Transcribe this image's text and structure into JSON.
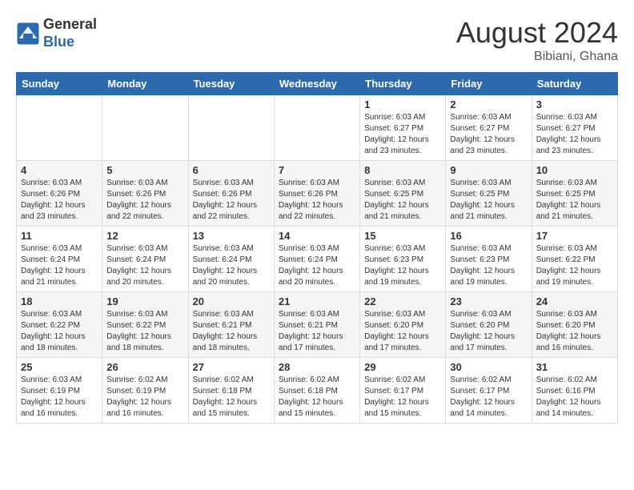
{
  "header": {
    "logo_line1": "General",
    "logo_line2": "Blue",
    "month_year": "August 2024",
    "location": "Bibiani, Ghana"
  },
  "weekdays": [
    "Sunday",
    "Monday",
    "Tuesday",
    "Wednesday",
    "Thursday",
    "Friday",
    "Saturday"
  ],
  "weeks": [
    [
      {
        "day": "",
        "sunrise": "",
        "sunset": "",
        "daylight": ""
      },
      {
        "day": "",
        "sunrise": "",
        "sunset": "",
        "daylight": ""
      },
      {
        "day": "",
        "sunrise": "",
        "sunset": "",
        "daylight": ""
      },
      {
        "day": "",
        "sunrise": "",
        "sunset": "",
        "daylight": ""
      },
      {
        "day": "1",
        "sunrise": "Sunrise: 6:03 AM",
        "sunset": "Sunset: 6:27 PM",
        "daylight": "Daylight: 12 hours and 23 minutes."
      },
      {
        "day": "2",
        "sunrise": "Sunrise: 6:03 AM",
        "sunset": "Sunset: 6:27 PM",
        "daylight": "Daylight: 12 hours and 23 minutes."
      },
      {
        "day": "3",
        "sunrise": "Sunrise: 6:03 AM",
        "sunset": "Sunset: 6:27 PM",
        "daylight": "Daylight: 12 hours and 23 minutes."
      }
    ],
    [
      {
        "day": "4",
        "sunrise": "Sunrise: 6:03 AM",
        "sunset": "Sunset: 6:26 PM",
        "daylight": "Daylight: 12 hours and 23 minutes."
      },
      {
        "day": "5",
        "sunrise": "Sunrise: 6:03 AM",
        "sunset": "Sunset: 6:26 PM",
        "daylight": "Daylight: 12 hours and 22 minutes."
      },
      {
        "day": "6",
        "sunrise": "Sunrise: 6:03 AM",
        "sunset": "Sunset: 6:26 PM",
        "daylight": "Daylight: 12 hours and 22 minutes."
      },
      {
        "day": "7",
        "sunrise": "Sunrise: 6:03 AM",
        "sunset": "Sunset: 6:26 PM",
        "daylight": "Daylight: 12 hours and 22 minutes."
      },
      {
        "day": "8",
        "sunrise": "Sunrise: 6:03 AM",
        "sunset": "Sunset: 6:25 PM",
        "daylight": "Daylight: 12 hours and 21 minutes."
      },
      {
        "day": "9",
        "sunrise": "Sunrise: 6:03 AM",
        "sunset": "Sunset: 6:25 PM",
        "daylight": "Daylight: 12 hours and 21 minutes."
      },
      {
        "day": "10",
        "sunrise": "Sunrise: 6:03 AM",
        "sunset": "Sunset: 6:25 PM",
        "daylight": "Daylight: 12 hours and 21 minutes."
      }
    ],
    [
      {
        "day": "11",
        "sunrise": "Sunrise: 6:03 AM",
        "sunset": "Sunset: 6:24 PM",
        "daylight": "Daylight: 12 hours and 21 minutes."
      },
      {
        "day": "12",
        "sunrise": "Sunrise: 6:03 AM",
        "sunset": "Sunset: 6:24 PM",
        "daylight": "Daylight: 12 hours and 20 minutes."
      },
      {
        "day": "13",
        "sunrise": "Sunrise: 6:03 AM",
        "sunset": "Sunset: 6:24 PM",
        "daylight": "Daylight: 12 hours and 20 minutes."
      },
      {
        "day": "14",
        "sunrise": "Sunrise: 6:03 AM",
        "sunset": "Sunset: 6:24 PM",
        "daylight": "Daylight: 12 hours and 20 minutes."
      },
      {
        "day": "15",
        "sunrise": "Sunrise: 6:03 AM",
        "sunset": "Sunset: 6:23 PM",
        "daylight": "Daylight: 12 hours and 19 minutes."
      },
      {
        "day": "16",
        "sunrise": "Sunrise: 6:03 AM",
        "sunset": "Sunset: 6:23 PM",
        "daylight": "Daylight: 12 hours and 19 minutes."
      },
      {
        "day": "17",
        "sunrise": "Sunrise: 6:03 AM",
        "sunset": "Sunset: 6:22 PM",
        "daylight": "Daylight: 12 hours and 19 minutes."
      }
    ],
    [
      {
        "day": "18",
        "sunrise": "Sunrise: 6:03 AM",
        "sunset": "Sunset: 6:22 PM",
        "daylight": "Daylight: 12 hours and 18 minutes."
      },
      {
        "day": "19",
        "sunrise": "Sunrise: 6:03 AM",
        "sunset": "Sunset: 6:22 PM",
        "daylight": "Daylight: 12 hours and 18 minutes."
      },
      {
        "day": "20",
        "sunrise": "Sunrise: 6:03 AM",
        "sunset": "Sunset: 6:21 PM",
        "daylight": "Daylight: 12 hours and 18 minutes."
      },
      {
        "day": "21",
        "sunrise": "Sunrise: 6:03 AM",
        "sunset": "Sunset: 6:21 PM",
        "daylight": "Daylight: 12 hours and 17 minutes."
      },
      {
        "day": "22",
        "sunrise": "Sunrise: 6:03 AM",
        "sunset": "Sunset: 6:20 PM",
        "daylight": "Daylight: 12 hours and 17 minutes."
      },
      {
        "day": "23",
        "sunrise": "Sunrise: 6:03 AM",
        "sunset": "Sunset: 6:20 PM",
        "daylight": "Daylight: 12 hours and 17 minutes."
      },
      {
        "day": "24",
        "sunrise": "Sunrise: 6:03 AM",
        "sunset": "Sunset: 6:20 PM",
        "daylight": "Daylight: 12 hours and 16 minutes."
      }
    ],
    [
      {
        "day": "25",
        "sunrise": "Sunrise: 6:03 AM",
        "sunset": "Sunset: 6:19 PM",
        "daylight": "Daylight: 12 hours and 16 minutes."
      },
      {
        "day": "26",
        "sunrise": "Sunrise: 6:02 AM",
        "sunset": "Sunset: 6:19 PM",
        "daylight": "Daylight: 12 hours and 16 minutes."
      },
      {
        "day": "27",
        "sunrise": "Sunrise: 6:02 AM",
        "sunset": "Sunset: 6:18 PM",
        "daylight": "Daylight: 12 hours and 15 minutes."
      },
      {
        "day": "28",
        "sunrise": "Sunrise: 6:02 AM",
        "sunset": "Sunset: 6:18 PM",
        "daylight": "Daylight: 12 hours and 15 minutes."
      },
      {
        "day": "29",
        "sunrise": "Sunrise: 6:02 AM",
        "sunset": "Sunset: 6:17 PM",
        "daylight": "Daylight: 12 hours and 15 minutes."
      },
      {
        "day": "30",
        "sunrise": "Sunrise: 6:02 AM",
        "sunset": "Sunset: 6:17 PM",
        "daylight": "Daylight: 12 hours and 14 minutes."
      },
      {
        "day": "31",
        "sunrise": "Sunrise: 6:02 AM",
        "sunset": "Sunset: 6:16 PM",
        "daylight": "Daylight: 12 hours and 14 minutes."
      }
    ]
  ]
}
